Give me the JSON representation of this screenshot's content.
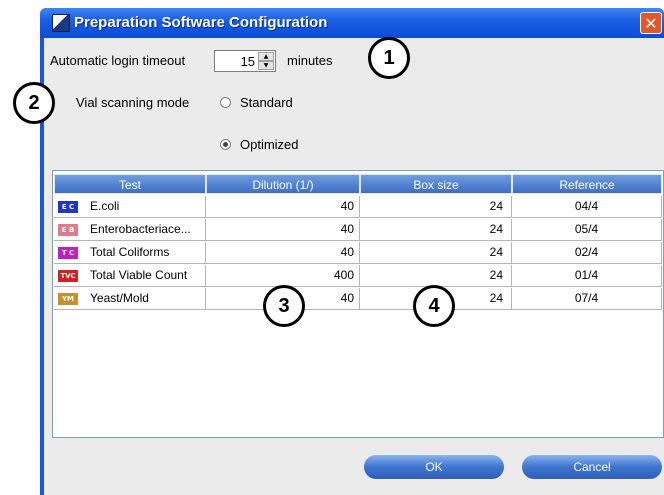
{
  "window": {
    "title": "Preparation Software Configuration",
    "close_glyph": "✕"
  },
  "login": {
    "label": "Automatic login timeout",
    "value": "15",
    "unit": "minutes"
  },
  "vial": {
    "label": "Vial scanning mode",
    "options": [
      "Standard",
      "Optimized"
    ],
    "selected": "Optimized"
  },
  "callouts": [
    "1",
    "2",
    "3",
    "4"
  ],
  "table": {
    "headers": [
      "Test",
      "Dilution (1/)",
      "Box size",
      "Reference"
    ],
    "rows": [
      {
        "badge": "E C",
        "badge_color": "#2233cc",
        "test": "E.coli",
        "dilution": "40",
        "box": "24",
        "ref": "04/4"
      },
      {
        "badge": "E B",
        "badge_color": "#e07c8a",
        "test": "Enterobacteriace...",
        "dilution": "40",
        "box": "24",
        "ref": "05/4"
      },
      {
        "badge": "T C",
        "badge_color": "#c020c0",
        "test": "Total Coliforms",
        "dilution": "40",
        "box": "24",
        "ref": "02/4"
      },
      {
        "badge": "TVC",
        "badge_color": "#d02020",
        "test": "Total Viable Count",
        "dilution": "400",
        "box": "24",
        "ref": "01/4"
      },
      {
        "badge": "YM",
        "badge_color": "#c8902a",
        "test": "Yeast/Mold",
        "dilution": "40",
        "box": "24",
        "ref": "07/4"
      }
    ]
  },
  "buttons": {
    "ok": "OK",
    "cancel": "Cancel"
  }
}
